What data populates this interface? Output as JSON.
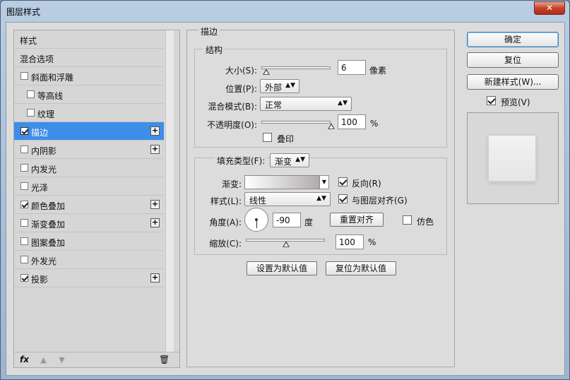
{
  "window": {
    "title": "图层样式",
    "close_label": "✕"
  },
  "sidebar": {
    "items": [
      {
        "label": "样式",
        "checkbox": false,
        "checked": false,
        "plus": false,
        "selected": false
      },
      {
        "label": "混合选项",
        "checkbox": false,
        "checked": false,
        "plus": false,
        "selected": false
      },
      {
        "label": "斜面和浮雕",
        "checkbox": true,
        "checked": false,
        "plus": false,
        "selected": false
      },
      {
        "label": "等高线",
        "checkbox": true,
        "checked": false,
        "plus": false,
        "selected": false,
        "indent": true
      },
      {
        "label": "纹理",
        "checkbox": true,
        "checked": false,
        "plus": false,
        "selected": false,
        "indent": true
      },
      {
        "label": "描边",
        "checkbox": true,
        "checked": true,
        "plus": true,
        "selected": true
      },
      {
        "label": "内阴影",
        "checkbox": true,
        "checked": false,
        "plus": true,
        "selected": false
      },
      {
        "label": "内发光",
        "checkbox": true,
        "checked": false,
        "plus": false,
        "selected": false
      },
      {
        "label": "光泽",
        "checkbox": true,
        "checked": false,
        "plus": false,
        "selected": false
      },
      {
        "label": "颜色叠加",
        "checkbox": true,
        "checked": true,
        "plus": true,
        "selected": false
      },
      {
        "label": "渐变叠加",
        "checkbox": true,
        "checked": false,
        "plus": true,
        "selected": false
      },
      {
        "label": "图案叠加",
        "checkbox": true,
        "checked": false,
        "plus": false,
        "selected": false
      },
      {
        "label": "外发光",
        "checkbox": true,
        "checked": false,
        "plus": false,
        "selected": false
      },
      {
        "label": "投影",
        "checkbox": true,
        "checked": true,
        "plus": true,
        "selected": false
      }
    ],
    "plus_symbol": "+",
    "footer": {
      "fx": "fx",
      "up": "▲",
      "down": "▼",
      "trash": "🗑"
    }
  },
  "stroke": {
    "section_title": "描边",
    "structure_title": "结构",
    "size_label": "大小(S):",
    "size_value": "6",
    "size_unit": "像素",
    "size_slider_fraction": 0.06,
    "position_label": "位置(P):",
    "position_value": "外部",
    "blend_label": "混合模式(B):",
    "blend_value": "正常",
    "opacity_label": "不透明度(O):",
    "opacity_value": "100",
    "opacity_unit": "%",
    "opacity_slider_fraction": 1.0,
    "overprint_label": "叠印",
    "overprint_checked": false
  },
  "fill": {
    "fill_type_label": "填充类型(F):",
    "fill_type_value": "渐变",
    "gradient_label": "渐变:",
    "reverse_label": "反向(R)",
    "reverse_checked": true,
    "style_label": "样式(L):",
    "style_value": "线性",
    "align_label": "与图层对齐(G)",
    "align_checked": true,
    "angle_label": "角度(A):",
    "angle_value": "-90",
    "angle_unit": "度",
    "reset_align_label": "重置对齐",
    "dither_label": "仿色",
    "dither_checked": false,
    "scale_label": "缩放(C):",
    "scale_value": "100",
    "scale_unit": "%",
    "scale_slider_fraction": 0.5
  },
  "defaults": {
    "set_default": "设置为默认值",
    "reset_default": "复位为默认值"
  },
  "actions": {
    "ok": "确定",
    "reset": "复位",
    "new_style": "新建样式(W)...",
    "preview_label": "预览(V)",
    "preview_checked": true
  },
  "colors": {
    "selection": "#3d8ee7",
    "panel": "#dcdcdc"
  },
  "dropdown_caret": "▲▼"
}
